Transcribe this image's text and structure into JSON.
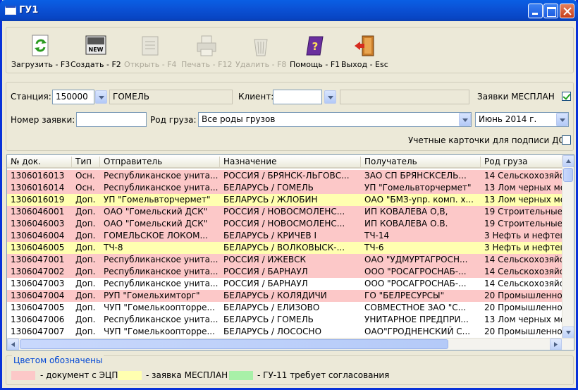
{
  "window": {
    "title": "ГУ1"
  },
  "toolbar": [
    {
      "label": "Загрузить - F3",
      "icon": "refresh-icon",
      "enabled": true
    },
    {
      "label": "Создать - F2",
      "icon": "new-document-icon",
      "enabled": true
    },
    {
      "label": "Открыть - F4",
      "icon": "open-document-icon",
      "enabled": false
    },
    {
      "label": "Печать - F12",
      "icon": "printer-icon",
      "enabled": false
    },
    {
      "label": "Удалить - F8",
      "icon": "trash-icon",
      "enabled": false
    },
    {
      "label": "Помощь - F1",
      "icon": "help-book-icon",
      "enabled": true
    },
    {
      "label": "Выход - Esc",
      "icon": "exit-door-icon",
      "enabled": true
    }
  ],
  "filters": {
    "station_label": "Станция:",
    "station_code": "150000",
    "station_name": "ГОМЕЛЬ",
    "client_label": "Клиент:",
    "client_value": "",
    "mesplan_label": "Заявки МЕСПЛАН",
    "mesplan_checked": true,
    "order_label": "Номер заявки:",
    "order_value": "",
    "cargo_label": "Род груза:",
    "cargo_value": "Все роды грузов",
    "period_value": "Июнь    2014 г.",
    "cards_label": "Учетные карточки для подписи ДС",
    "cards_checked": false
  },
  "table": {
    "columns": [
      "№ док.",
      "Тип",
      "Отправитель",
      "Назначение",
      "Получатель",
      "Род груза"
    ],
    "rows": [
      {
        "color": "pink",
        "cells": [
          "1306016013",
          "Осн.",
          "Республиканское унита...",
          "РОССИЯ / БРЯНСК-ЛЬГОВС...",
          "ЗАО СП БРЯНСКСЕЛЬ...",
          "14 Сельскохозяйс"
        ]
      },
      {
        "color": "pink",
        "cells": [
          "1306016014",
          "Осн.",
          "Республиканское унита...",
          "БЕЛАРУСЬ / ГОМЕЛЬ",
          "УП \"Гомельвторчермет\"",
          "13 Лом черных ме"
        ]
      },
      {
        "color": "yellow",
        "cells": [
          "1306016019",
          "Доп.",
          "УП \"Гомельвторчермет\"",
          "БЕЛАРУСЬ / ЖЛОБИН",
          "ОАО \"БМЗ-упр. комп. х...",
          "13 Лом черных ме"
        ]
      },
      {
        "color": "pink",
        "cells": [
          "1306046001",
          "Доп.",
          "ОАО \"Гомельский ДСК\"",
          "РОССИЯ / НОВОСМОЛЕНС...",
          "ИП КОВАЛЕВА О,В,",
          "19 Строительные"
        ]
      },
      {
        "color": "pink",
        "cells": [
          "1306046003",
          "Доп.",
          "ОАО \"Гомельский ДСК\"",
          "РОССИЯ / НОВОСМОЛЕНС...",
          "ИП КОВАЛЕВА О.В.",
          "19 Строительные"
        ]
      },
      {
        "color": "pink",
        "cells": [
          "1306046004",
          "Доп.",
          "ГОМЕЛЬСКОЕ ЛОКОМ...",
          "БЕЛАРУСЬ / КРИЧЕВ I",
          "ТЧ-14",
          "3 Нефть и нефтеп"
        ]
      },
      {
        "color": "yellow",
        "cells": [
          "1306046005",
          "Доп.",
          "ТЧ-8",
          "БЕЛАРУСЬ / ВОЛКОВЫСК-...",
          "ТЧ-6",
          "3 Нефть и нефтеп"
        ]
      },
      {
        "color": "pink",
        "cells": [
          "1306047001",
          "Доп.",
          "Республиканское унита...",
          "РОССИЯ / ИЖЕВСК",
          "ОАО \"УДМУРТАГРОСН...",
          "14 Сельскохозяйс"
        ]
      },
      {
        "color": "pink",
        "cells": [
          "1306047002",
          "Доп.",
          "Республиканское унита...",
          "РОССИЯ / БАРНАУЛ",
          "ООО \"РОСАГРОСНАБ-...",
          "14 Сельскохозяйс"
        ]
      },
      {
        "color": "white",
        "cells": [
          "1306047003",
          "Доп.",
          "Республиканское унита...",
          "РОССИЯ / БАРНАУЛ",
          "ООО \"РОСАГРОСНАБ-...",
          "14 Сельскохозяйс"
        ]
      },
      {
        "color": "pink",
        "cells": [
          "1306047004",
          "Доп.",
          "РУП \"Гомельхимторг\"",
          "БЕЛАРУСЬ / КОЛЯДИЧИ",
          "ГО \"БЕЛРЕСУРСЫ\"",
          "20 Промышленно"
        ]
      },
      {
        "color": "white",
        "cells": [
          "1306047005",
          "Доп.",
          "ЧУП \"Гомелькоопторре...",
          "БЕЛАРУСЬ / ЕЛИЗОВО",
          "СОВМЕСТНОЕ ЗАО \"С...",
          "20 Промышленно"
        ]
      },
      {
        "color": "white",
        "cells": [
          "1306047006",
          "Доп.",
          "Республиканское унита...",
          "БЕЛАРУСЬ / ГОМЕЛЬ",
          "УНИТАРНОЕ ПРЕДПРИ...",
          "13 Лом черных ме"
        ]
      },
      {
        "color": "white",
        "cells": [
          "1306047007",
          "Доп.",
          "ЧУП \"Гомелькоопторре...",
          "БЕЛАРУСЬ / ЛОСОСНО",
          "ОАО\"ГРОДНЕНСКИЙ С...",
          "20 Промышленно"
        ]
      }
    ]
  },
  "legend": {
    "title": "Цветом обозначены",
    "items": [
      {
        "color": "#FCC8C8",
        "label": "- документ с ЭЦП"
      },
      {
        "color": "#FFFFB0",
        "label": "- заявка МЕСПЛАН"
      },
      {
        "color": "#A8F0A8",
        "label": "- ГУ-11 требует согласования"
      }
    ]
  }
}
